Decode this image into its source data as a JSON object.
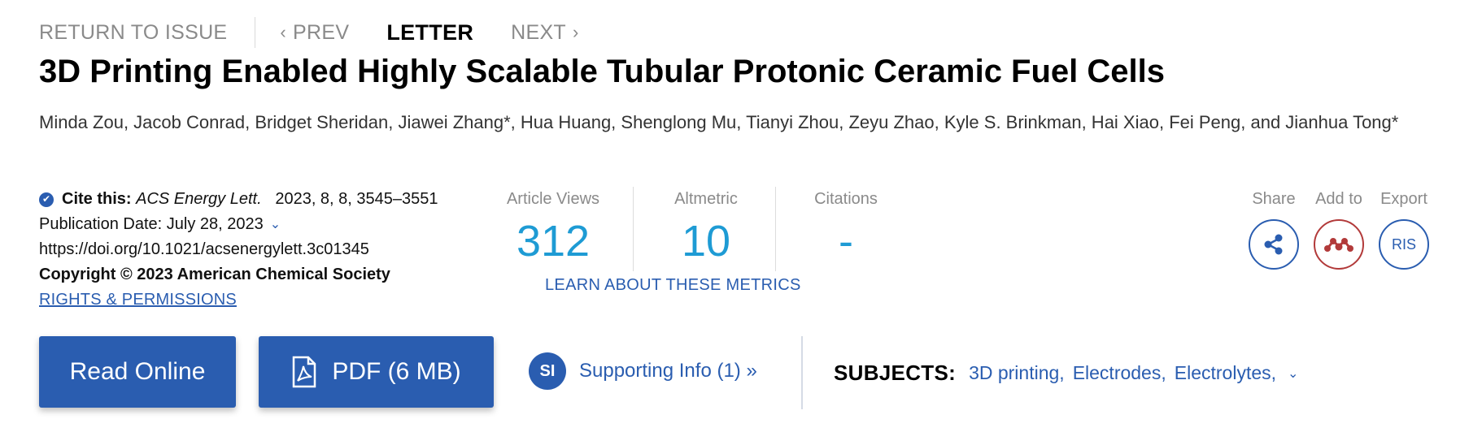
{
  "nav": {
    "return_label": "RETURN TO ISSUE",
    "prev_label": "PREV",
    "current_label": "LETTER",
    "next_label": "NEXT"
  },
  "article": {
    "title": "3D Printing Enabled Highly Scalable Tubular Protonic Ceramic Fuel Cells",
    "authors": "Minda Zou, Jacob Conrad, Bridget Sheridan, Jiawei Zhang*, Hua Huang, Shenglong Mu, Tianyi Zhou, Zeyu Zhao, Kyle S. Brinkman, Hai Xiao, Fei Peng, and Jianhua Tong*"
  },
  "cite": {
    "label": "Cite this:",
    "journal": "ACS Energy Lett.",
    "ref": "2023, 8, 8, 3545–3551",
    "pub_date": "Publication Date: July 28, 2023",
    "doi": "https://doi.org/10.1021/acsenergylett.3c01345",
    "copyright": "Copyright © 2023 American Chemical Society",
    "rights": "RIGHTS & PERMISSIONS"
  },
  "metrics": {
    "views_label": "Article Views",
    "views_value": "312",
    "altmetric_label": "Altmetric",
    "altmetric_value": "10",
    "citations_label": "Citations",
    "citations_value": "-",
    "learn_link": "LEARN ABOUT THESE METRICS"
  },
  "tools": {
    "share_label": "Share",
    "add_label": "Add to",
    "export_label": "Export",
    "export_format": "RIS"
  },
  "actions": {
    "read_online": "Read Online",
    "pdf": "PDF (6 MB)",
    "si_badge": "SI",
    "supporting_info": "Supporting Info (1) »"
  },
  "subjects": {
    "heading": "SUBJECTS:",
    "items": [
      "3D printing",
      "Electrodes",
      "Electrolytes"
    ]
  },
  "colors": {
    "accent": "#2a5db0",
    "metric_value": "#1e9bd4",
    "mendeley": "#b23a3a"
  }
}
